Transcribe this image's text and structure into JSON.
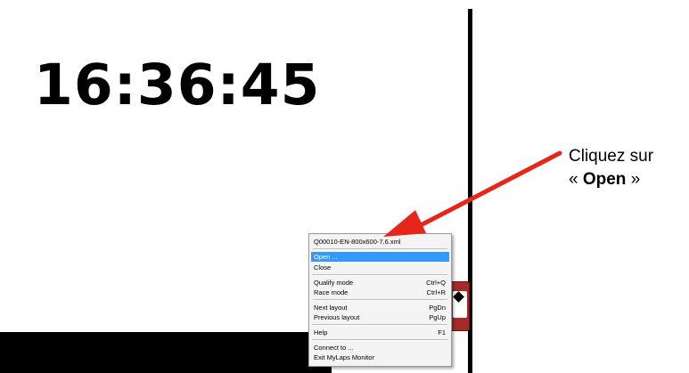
{
  "clock": {
    "time": "16:36:45"
  },
  "context_menu": {
    "file_name": "Q00010-EN-800x600-7.6.xml",
    "items": [
      {
        "label": "Open ...",
        "shortcut": ""
      },
      {
        "label": "Close",
        "shortcut": ""
      },
      {
        "label": "Qualify mode",
        "shortcut": "Ctrl+Q"
      },
      {
        "label": "Race mode",
        "shortcut": "Ctrl+R"
      },
      {
        "label": "Next layout",
        "shortcut": "PgDn"
      },
      {
        "label": "Previous layout",
        "shortcut": "PgUp"
      },
      {
        "label": "Help",
        "shortcut": "F1"
      },
      {
        "label": "Connect to ...",
        "shortcut": ""
      },
      {
        "label": "Exit MyLaps Monitor",
        "shortcut": ""
      }
    ]
  },
  "annotation": {
    "line1": "Cliquez sur",
    "open_quote": "« ",
    "open_word": "Open",
    "close_quote": " »"
  },
  "colors": {
    "highlight": "#3399ff",
    "arrow": "#e8251b",
    "accent_box": "#a52a2a"
  }
}
